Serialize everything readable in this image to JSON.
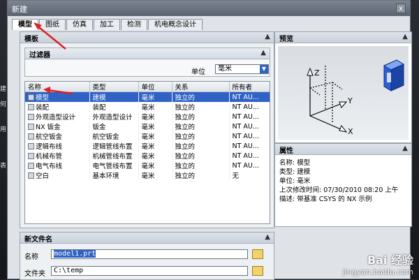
{
  "window": {
    "title": "新建",
    "close": "x"
  },
  "tabs": [
    "模型",
    "图纸",
    "仿真",
    "加工",
    "检测",
    "机电概念设计"
  ],
  "templates": {
    "title": "模板",
    "filter_title": "过滤器",
    "unit_label": "单位",
    "unit_value": "毫米",
    "columns": [
      "名称",
      "类型",
      "单位",
      "关系",
      "所有者"
    ],
    "rows": [
      {
        "name": "模型",
        "type": "建模",
        "unit": "毫米",
        "rel": "独立的",
        "owner": "NT AU..."
      },
      {
        "name": "装配",
        "type": "装配",
        "unit": "毫米",
        "rel": "独立的",
        "owner": "NT AU..."
      },
      {
        "name": "外观造型设计",
        "type": "外观造型设计",
        "unit": "毫米",
        "rel": "独立的",
        "owner": "NT AU..."
      },
      {
        "name": "NX 钣金",
        "type": "钣金",
        "unit": "毫米",
        "rel": "独立的",
        "owner": "NT AU..."
      },
      {
        "name": "航空钣金",
        "type": "航空钣金",
        "unit": "毫米",
        "rel": "独立的",
        "owner": "NT AU..."
      },
      {
        "name": "逻辑布线",
        "type": "逻辑管线布置",
        "unit": "毫米",
        "rel": "独立的",
        "owner": "NT AU..."
      },
      {
        "name": "机械布管",
        "type": "机械管线布置",
        "unit": "毫米",
        "rel": "独立的",
        "owner": "NT AU..."
      },
      {
        "name": "电气布线",
        "type": "电气管线布置",
        "unit": "毫米",
        "rel": "独立的",
        "owner": "NT AU..."
      },
      {
        "name": "空白",
        "type": "基本环境",
        "unit": "毫米",
        "rel": "独立的",
        "owner": "无"
      }
    ]
  },
  "preview": {
    "title": "预览",
    "axis_x": "X",
    "axis_y": "Y",
    "axis_z": "Z"
  },
  "properties": {
    "title": "属性",
    "lines": [
      "名称: 模型",
      "类型: 建模",
      "单位: 毫米",
      "上次修改时间: 07/30/2010 08:20 上午",
      "描述: 带基准 CSYS 的 NX 示例"
    ]
  },
  "newfile": {
    "title": "新文件名",
    "name_label": "名称",
    "name_value": "model1.prt",
    "folder_label": "文件夹",
    "folder_value": "C:\\temp"
  },
  "watermark": {
    "brand": "Bai 经验",
    "url": "jingyan.baidu.com"
  },
  "left_fragments": [
    "建",
    "何",
    "用",
    "表"
  ],
  "colors": {
    "selection": "#2f62c4",
    "arrow": "#e02020"
  }
}
